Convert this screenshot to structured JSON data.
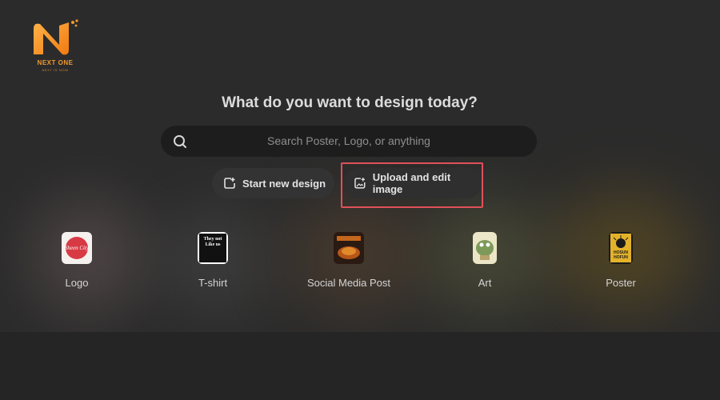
{
  "brand": {
    "name": "NEXT ONE",
    "tagline": "NEXT IS NOW"
  },
  "headline": "What do you want to design today?",
  "search": {
    "placeholder": "Search Poster, Logo, or anything",
    "icon": "search-icon"
  },
  "actions": {
    "start_new_design": "Start new design",
    "upload_and_edit": "Upload and edit image"
  },
  "categories": [
    {
      "label": "Logo",
      "thumb_text": "Sheen City",
      "color": "#d83a43"
    },
    {
      "label": "T-shirt",
      "thumb_text": "They not Like us",
      "color": "#111111"
    },
    {
      "label": "Social Media Post",
      "thumb_text": "",
      "color": "#c4661c"
    },
    {
      "label": "Art",
      "thumb_text": "",
      "color": "#9db06e"
    },
    {
      "label": "Poster",
      "thumb_text": "HOSUN HOFUN",
      "color": "#e3b22b"
    }
  ],
  "colors": {
    "accent": "#f29a2e",
    "highlight": "#e0505a",
    "background": "#2b2b2b"
  }
}
